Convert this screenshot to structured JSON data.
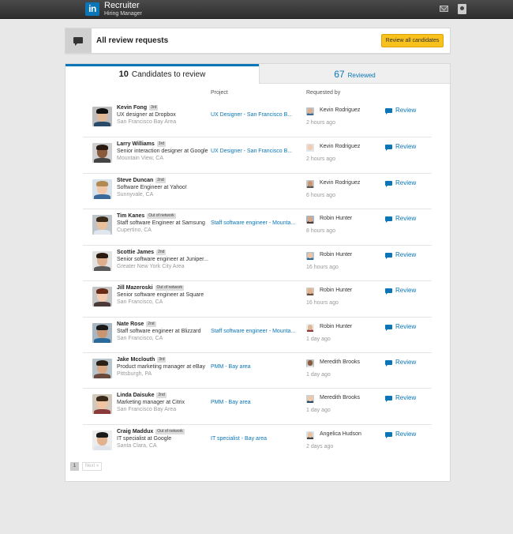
{
  "app": {
    "logo": "in",
    "brand_title": "Recruiter",
    "brand_subtitle": "Hiring Manager",
    "icons": [
      "mail-icon",
      "profile-icon"
    ]
  },
  "header": {
    "title": "All review requests",
    "review_all_label": "Review all candidates",
    "accent_color": "#f9c11c"
  },
  "tabs": {
    "to_review_count": "10",
    "to_review_label": "Candidates to review",
    "reviewed_count": "67",
    "reviewed_label": "Reviewed",
    "active_color": "#0a76b7"
  },
  "columns": {
    "project": "Project",
    "requested_by": "Requested by"
  },
  "review_label": "Review",
  "candidates": [
    {
      "name": "Kevin Fong",
      "degree": "3rd",
      "title": "UX designer at Dropbox",
      "location": "San Francisco Bay Area",
      "project": "UX Designer - San Francisco B...",
      "requester": "Kevin Rodriguez",
      "time": "2 hours ago"
    },
    {
      "name": "Larry Williams",
      "degree": "3rd",
      "title": "Senior interaction designer at Google",
      "location": "Mountain View, CA",
      "project": "UX Designer - San Francisco B...",
      "requester": "Kevin Rodriguez",
      "time": "2 hours ago"
    },
    {
      "name": "Steve Duncan",
      "degree": "2nd",
      "title": "Software Engineer at Yahoo!",
      "location": "Sunnyvale, CA",
      "project": "",
      "requester": "Kevin Rodriguez",
      "time": "6 hours ago"
    },
    {
      "name": "Tim Kanes",
      "degree": "Out of network",
      "title": "Staff software Engineer at Samsung",
      "location": "Cupertino, CA",
      "project": "Staff software engineer - Mounta...",
      "requester": "Robin Hunter",
      "time": "8 hours ago"
    },
    {
      "name": "Scottie James",
      "degree": "2nd",
      "title": "Senior software engineer at Juniper...",
      "location": "Greater New York City Area",
      "project": "",
      "requester": "Robin Hunter",
      "time": "16 hours ago"
    },
    {
      "name": "Jill Mazeroski",
      "degree": "Out of network",
      "title": "Senior software engineer at Square",
      "location": "San Francisco, CA",
      "project": "",
      "requester": "Robin Hunter",
      "time": "16 hours ago"
    },
    {
      "name": "Nate Rose",
      "degree": "2nd",
      "title": "Staff software engineer at Blizzard",
      "location": "San Francisco, CA",
      "project": "Staff software engineer - Mounta...",
      "requester": "Robin Hunter",
      "time": "1 day ago"
    },
    {
      "name": "Jake Mcclouth",
      "degree": "3rd",
      "title": "Product marketing manager at eBay",
      "location": "Pittsburgh, PA",
      "project": "PMM - Bay area",
      "requester": "Meredith Brooks",
      "time": "1 day ago"
    },
    {
      "name": "Linda Daisuke",
      "degree": "2nd",
      "title": "Marketing manager at Citrix",
      "location": "San Francisco Bay Area",
      "project": "PMM - Bay area",
      "requester": "Meredith Brooks",
      "time": "1 day ago"
    },
    {
      "name": "Craig Maddux",
      "degree": "Out of network",
      "title": "IT specialist at Google",
      "location": "Santa Clara, CA",
      "project": "IT specialist - Bay area",
      "requester": "Angelica Hudson",
      "time": "2 days ago"
    }
  ],
  "pagination": {
    "current": "1",
    "next_label": "Next »"
  }
}
